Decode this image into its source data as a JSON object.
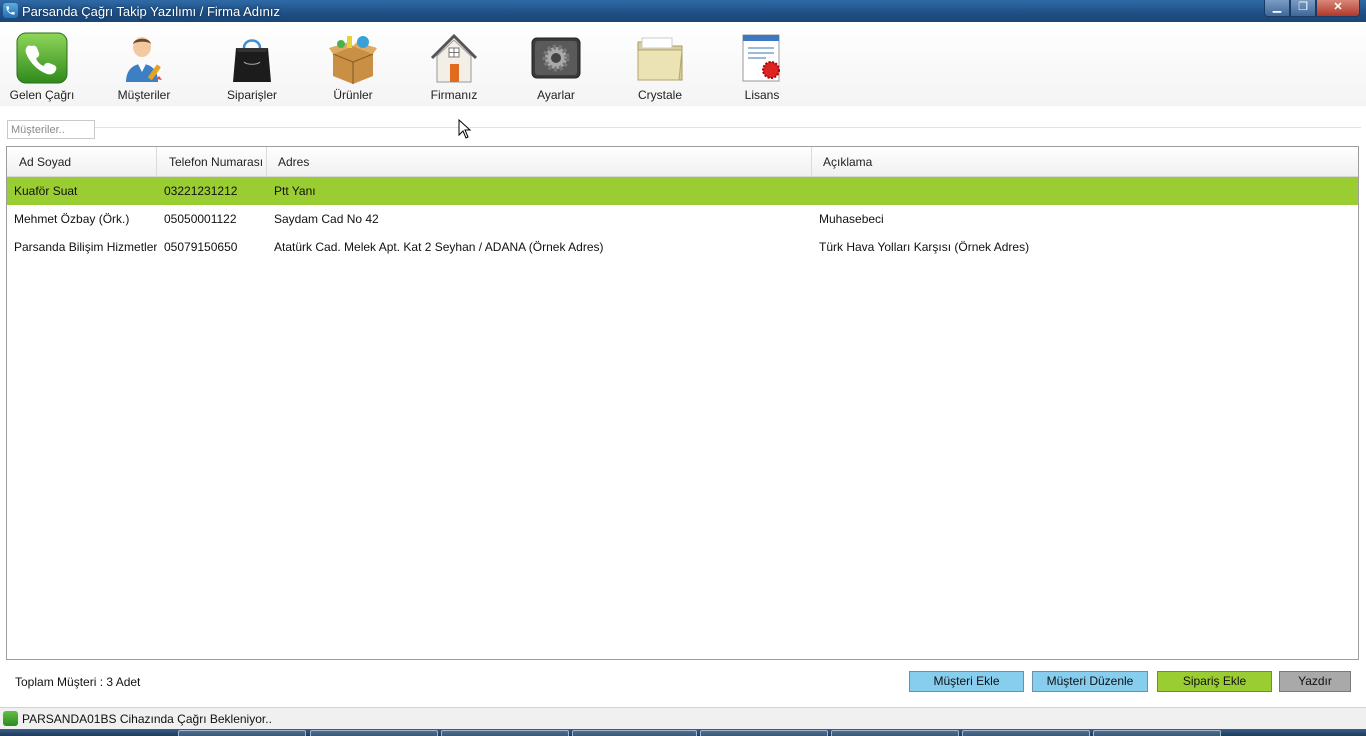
{
  "window": {
    "title": "Parsanda Çağrı Takip Yazılımı / Firma Adınız",
    "minimize": "▁",
    "maximize": "❐",
    "close": "✕"
  },
  "toolbar": {
    "items": [
      {
        "label": "Gelen Çağrı",
        "icon": "phone-icon"
      },
      {
        "label": "Müşteriler",
        "icon": "customer-icon"
      },
      {
        "label": "Siparişler",
        "icon": "shopping-bag-icon"
      },
      {
        "label": "Ürünler",
        "icon": "box-icon"
      },
      {
        "label": "Firmanız",
        "icon": "house-icon"
      },
      {
        "label": "Ayarlar",
        "icon": "gear-icon"
      },
      {
        "label": "Crystale",
        "icon": "folder-icon"
      },
      {
        "label": "Lisans",
        "icon": "certificate-icon"
      }
    ]
  },
  "search": {
    "placeholder": "Müşteriler..",
    "value": ""
  },
  "grid": {
    "columns": [
      "Ad Soyad",
      "Telefon Numarası",
      "Adres",
      "Açıklama"
    ],
    "rows": [
      {
        "name": "Kuaför Suat",
        "phone": "03221231212",
        "address": "Ptt Yanı",
        "note": "",
        "selected": true
      },
      {
        "name": "Mehmet Özbay (Örk.)",
        "phone": "05050001122",
        "address": "Saydam Cad No 42",
        "note": "Muhasebeci",
        "selected": false
      },
      {
        "name": "Parsanda Bilişim Hizmetleri",
        "phone": "05079150650",
        "address": "Atatürk Cad. Melek Apt. Kat 2 Seyhan / ADANA  (Örnek Adres)",
        "note": "Türk Hava Yolları Karşısı  (Örnek Adres)",
        "selected": false
      }
    ]
  },
  "footer": {
    "total": "Toplam Müşteri : 3 Adet",
    "buttons": {
      "add_customer": "Müşteri Ekle",
      "edit_customer": "Müşteri Düzenle",
      "add_order": "Sipariş Ekle",
      "print": "Yazdır"
    }
  },
  "status": {
    "text": "PARSANDA01BS Cihazında Çağrı Bekleniyor.."
  },
  "colors": {
    "selected_row": "#9acd32",
    "blue_button": "#87cdee",
    "green_button": "#9acd32",
    "gray_button": "#a9a9a9",
    "title_bar": "#1f4f85"
  }
}
